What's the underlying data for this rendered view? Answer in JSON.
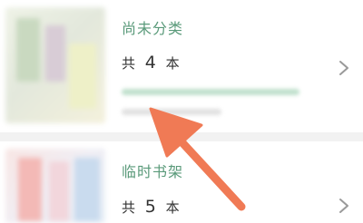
{
  "shelves": [
    {
      "title": "尚未分类",
      "count_prefix": "共",
      "count": "4",
      "count_suffix": "本"
    },
    {
      "title": "临时书架",
      "count_prefix": "共",
      "count": "5",
      "count_suffix": "本"
    }
  ],
  "colors": {
    "accent_green": "#5a9a7a",
    "annotation_arrow": "#f07a55",
    "background": "#f2f2f2"
  },
  "icons": {
    "chevron": "chevron-right-icon",
    "annotation": "pointer-arrow-icon"
  }
}
